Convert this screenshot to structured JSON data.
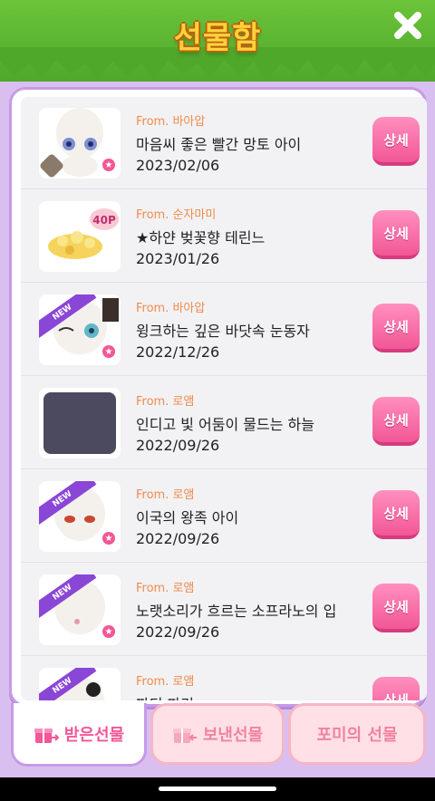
{
  "header": {
    "title": "선물함"
  },
  "gifts": [
    {
      "from": "From. 바아압",
      "name": "마음씨 좋은 빨간 망토 아이",
      "date": "2023/02/06",
      "button": "상세",
      "badge": ""
    },
    {
      "from": "From. 순자마미",
      "name": "★하얀 벚꽃향 테린느",
      "date": "2023/01/26",
      "button": "상세",
      "badge": "40P"
    },
    {
      "from": "From. 바아압",
      "name": "윙크하는 깊은 바닷속 눈동자",
      "date": "2022/12/26",
      "button": "상세",
      "badge": "NEW"
    },
    {
      "from": "From. 로앰",
      "name": "인디고 빛 어둠이 물드는 하늘",
      "date": "2022/09/26",
      "button": "상세",
      "badge": ""
    },
    {
      "from": "From. 로앰",
      "name": "이국의 왕족 아이",
      "date": "2022/09/26",
      "button": "상세",
      "badge": "NEW"
    },
    {
      "from": "From. 로앰",
      "name": "노랫소리가 흐르는 소프라노의 입",
      "date": "2022/09/26",
      "button": "상세",
      "badge": "NEW"
    },
    {
      "from": "From. 로앰",
      "name": "파티 파리",
      "date": "",
      "button": "상세",
      "badge": "NEW"
    }
  ],
  "tabs": [
    {
      "label": "받은선물"
    },
    {
      "label": "보낸선물"
    },
    {
      "label": "포미의 선물"
    }
  ],
  "colors": {
    "accent": "#f25796",
    "header_green": "#5cb832",
    "panel_border": "#c79ae8"
  }
}
